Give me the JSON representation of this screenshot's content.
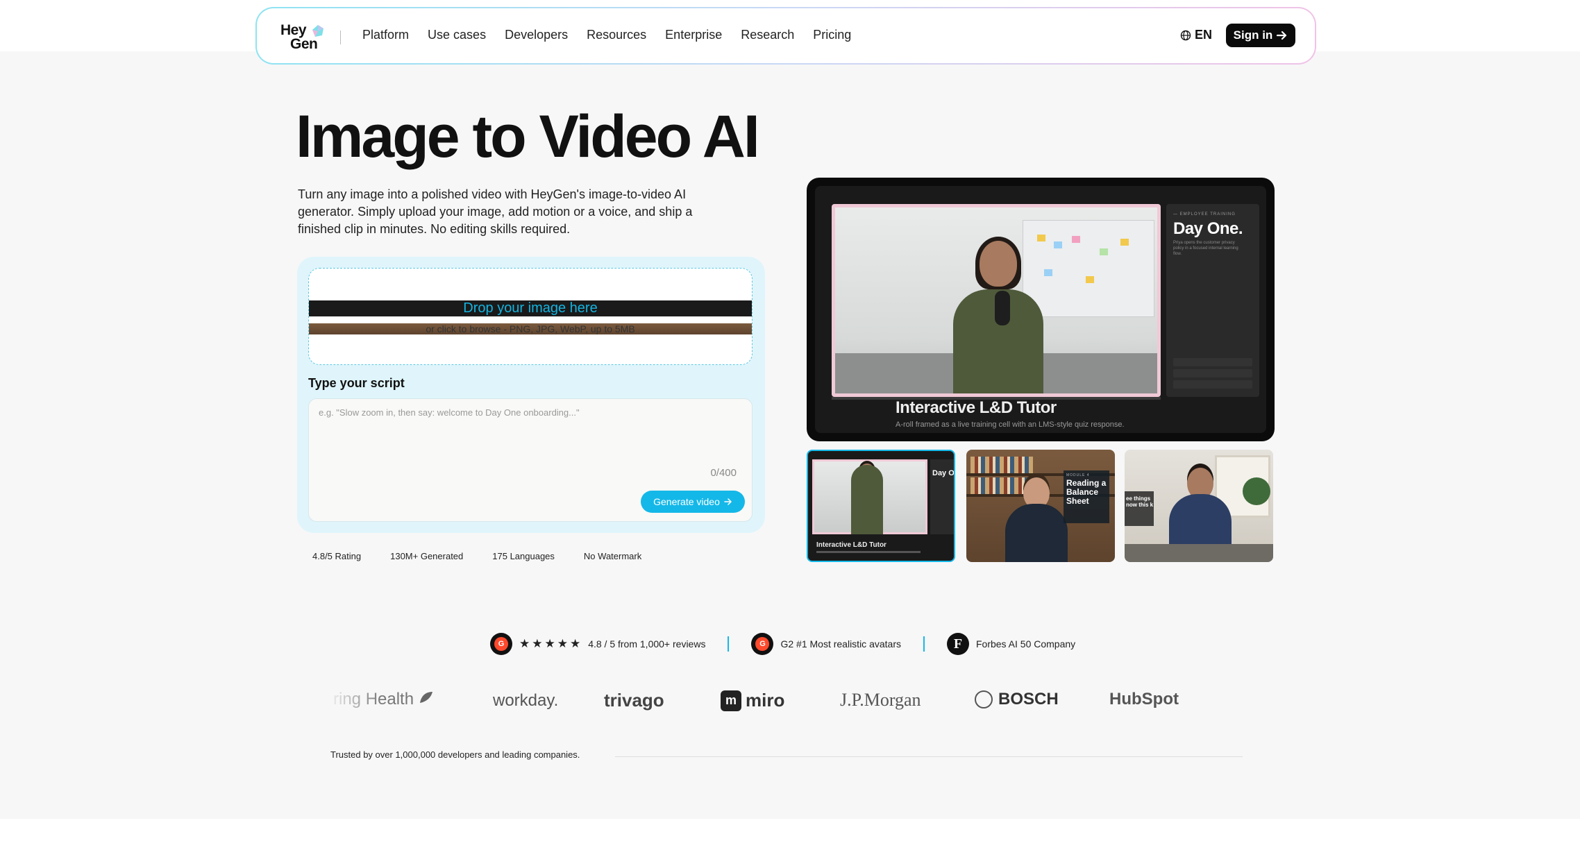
{
  "nav": {
    "logo_line1": "Hey",
    "logo_line2": "Gen",
    "links": [
      "Platform",
      "Use cases",
      "Developers",
      "Resources",
      "Enterprise",
      "Research",
      "Pricing"
    ],
    "lang": "EN",
    "signin": "Sign in"
  },
  "hero": {
    "title": "Image to Video AI",
    "description": "Turn any image into a polished video with HeyGen's image-to-video AI generator. Simply upload your image, add motion or a voice, and ship a finished clip in minutes. No editing skills required."
  },
  "upload": {
    "drop_title": "Drop your image here",
    "drop_sub": "or click to browse - PNG, JPG, WebP, up to 5MB",
    "script_label": "Type your script",
    "script_placeholder": "e.g. \"Slow zoom in, then say: welcome to Day One onboarding...\"",
    "counter": "0/400",
    "generate": "Generate video"
  },
  "stats": [
    "4.8/5 Rating",
    "130M+ Generated",
    "175 Languages",
    "No Watermark"
  ],
  "preview": {
    "side_kicker": "— EMPLOYEE TRAINING",
    "side_title": "Day One.",
    "side_text": "Priya opens the customer privacy policy in a focused internal learning flow.",
    "title": "Interactive L&D Tutor",
    "subtitle": "A-roll framed as a live training cell with an LMS-style quiz response."
  },
  "thumbs": [
    {
      "side": "Day O",
      "caption": "Interactive L&D Tutor"
    },
    {
      "kicker": "MODULE 4",
      "title": "Reading a Balance Sheet"
    },
    {
      "tag": "ee things now this k"
    }
  ],
  "reviews": {
    "g2_rating": "4.8 / 5 from 1,000+ reviews",
    "g2_award": "G2 #1 Most realistic avatars",
    "forbes": "Forbes AI 50 Company",
    "g2_mark": "G",
    "forbes_mark": "F"
  },
  "logos": {
    "health": "ring Health",
    "workday": "workday.",
    "trivago": "trivago",
    "miro_mark": "m",
    "miro": "miro",
    "jpm": "J.P.Morgan",
    "bosch": "BOSCH",
    "hubspot": "HubSpot"
  },
  "trusted": "Trusted by over 1,000,000 developers and leading companies.",
  "colors": {
    "accent": "#14b8e8",
    "dark": "#0b0b0b",
    "g2": "#ff492c"
  }
}
